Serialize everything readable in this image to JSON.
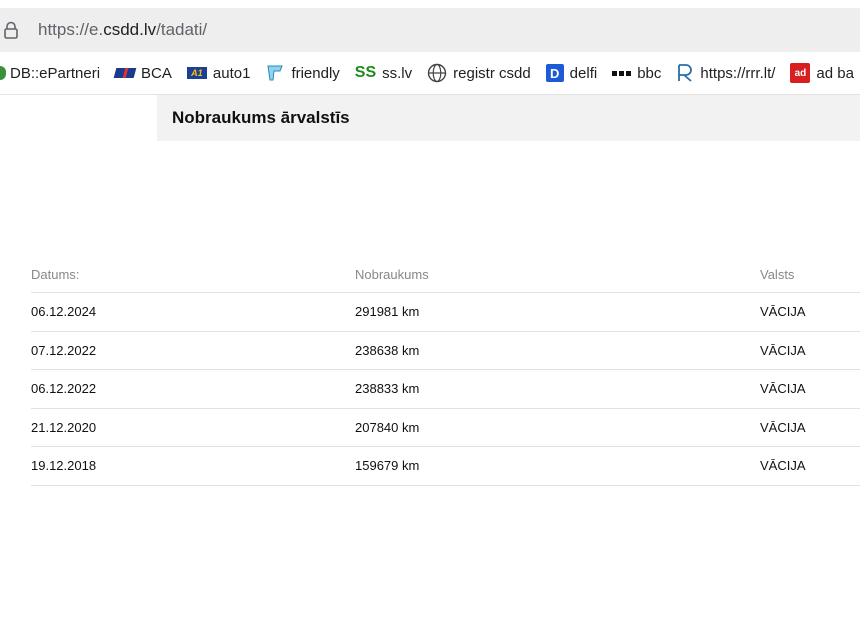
{
  "browser": {
    "url_prefix": "https://e.",
    "url_host": "csdd.lv",
    "url_path": "/tadati/"
  },
  "bookmarks": [
    {
      "label": "DB::ePartneri",
      "icon": "green-leaf-icon"
    },
    {
      "label": "BCA",
      "icon": "bca-icon"
    },
    {
      "label": "auto1",
      "icon": "auto1-icon",
      "icon_text": "A1"
    },
    {
      "label": "friendly",
      "icon": "friendly-icon"
    },
    {
      "label": "ss.lv",
      "icon": "ss-icon",
      "icon_text": "SS"
    },
    {
      "label": "registr csdd",
      "icon": "globe-icon"
    },
    {
      "label": "delfi",
      "icon": "delfi-icon",
      "icon_text": "D"
    },
    {
      "label": "bbc",
      "icon": "bbc-icon"
    },
    {
      "label": "https://rrr.lt/",
      "icon": "rrr-icon"
    },
    {
      "label": "ad ba",
      "icon": "ad-icon",
      "icon_text": "ad"
    }
  ],
  "page": {
    "title": "Nobraukums ārvalstīs"
  },
  "table": {
    "headers": [
      "Datums:",
      "Nobraukums",
      "Valsts"
    ],
    "rows": [
      [
        "06.12.2024",
        "291981 km",
        "VĀCIJA"
      ],
      [
        "07.12.2022",
        "238638 km",
        "VĀCIJA"
      ],
      [
        "06.12.2022",
        "238833 km",
        "VĀCIJA"
      ],
      [
        "21.12.2020",
        "207840 km",
        "VĀCIJA"
      ],
      [
        "19.12.2018",
        "159679 km",
        "VĀCIJA"
      ]
    ]
  }
}
